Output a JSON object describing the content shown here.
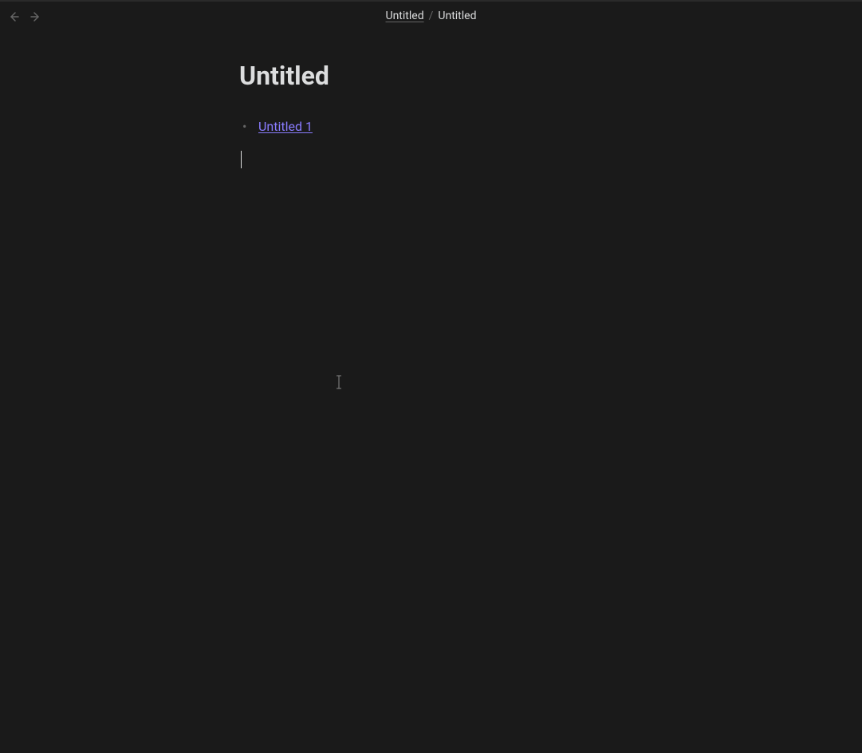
{
  "breadcrumb": {
    "parent": "Untitled",
    "separator": "/",
    "current": "Untitled"
  },
  "page": {
    "title": "Untitled"
  },
  "content": {
    "bullet_items": [
      {
        "link_text": "Untitled 1"
      }
    ]
  }
}
